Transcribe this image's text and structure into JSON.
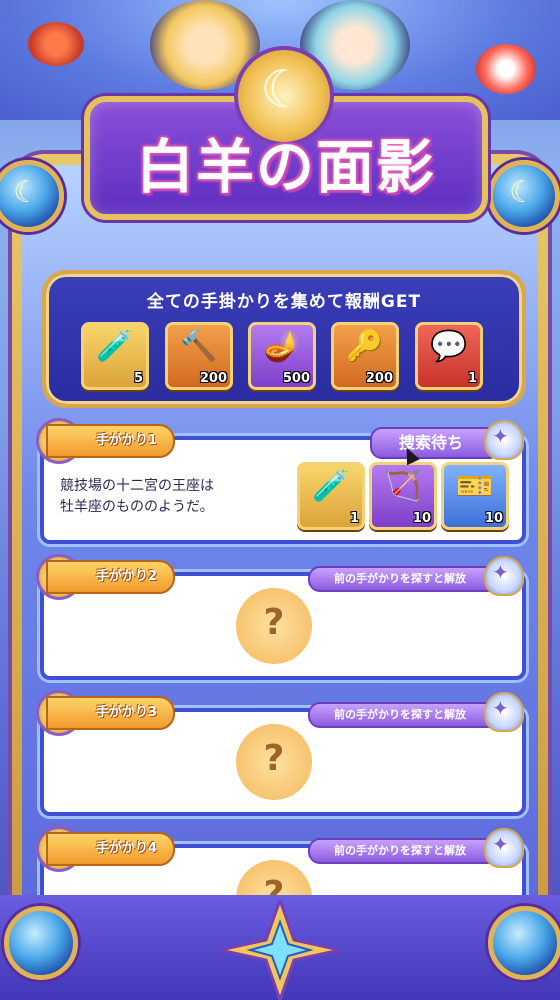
{
  "title": "白羊の面影",
  "reward_panel": {
    "header": "全ての手掛かりを集めて報酬GET",
    "items": [
      {
        "icon": "purple-potion-icon",
        "glyph": "🧪",
        "qty": "5",
        "bg": "gold"
      },
      {
        "icon": "hammer-icon",
        "glyph": "🔨",
        "qty": "200",
        "bg": "orange"
      },
      {
        "icon": "magic-lamp-icon",
        "glyph": "🪔",
        "qty": "500",
        "bg": "purple"
      },
      {
        "icon": "wind-up-key-icon",
        "glyph": "🔑",
        "qty": "200",
        "bg": "orange"
      },
      {
        "icon": "speech-bubble-icon",
        "glyph": "💬",
        "qty": "1",
        "bg": "red"
      }
    ]
  },
  "clues": [
    {
      "label": "手がかり1",
      "status": "捜索待ち",
      "text_lines": [
        "競技場の十二宮の王座は",
        "牡羊座のもののようだ。"
      ],
      "rewards": [
        {
          "icon": "purple-potion-icon",
          "glyph": "🧪",
          "qty": "1",
          "bg": "gold"
        },
        {
          "icon": "arrow-bundle-icon",
          "glyph": "🏹",
          "qty": "10",
          "bg": "purple"
        },
        {
          "icon": "five-min-ticket-icon",
          "glyph": "🎫",
          "qty": "10",
          "bg": "blue"
        }
      ]
    },
    {
      "label": "手がかり2",
      "status": "前の手がかりを探すと解放",
      "locked_symbol": "?"
    },
    {
      "label": "手がかり3",
      "status": "前の手がかりを探すと解放",
      "locked_symbol": "?"
    },
    {
      "label": "手がかり4",
      "status": "前の手がかりを探すと解放",
      "locked_symbol": "?"
    }
  ],
  "colors": {
    "accent": "#3f4fd6",
    "gold": "#e7c15b",
    "title_purple": "#5d2ec0"
  }
}
